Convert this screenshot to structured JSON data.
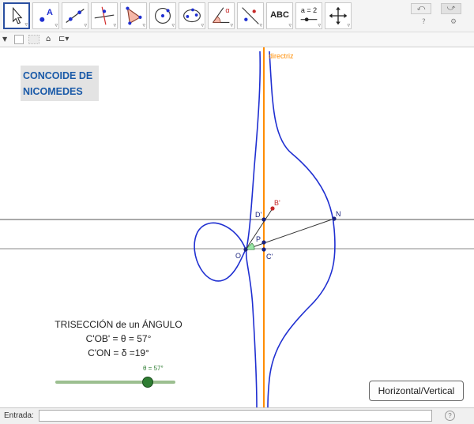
{
  "toolbar": {
    "tools": [
      {
        "name": "move-tool",
        "icon": "arrow-pointer-icon"
      },
      {
        "name": "point-tool",
        "icon": "point-a-icon",
        "label": "A"
      },
      {
        "name": "line-tool",
        "icon": "line-through-points-icon"
      },
      {
        "name": "perpendicular-tool",
        "icon": "perpendicular-line-icon"
      },
      {
        "name": "polygon-tool",
        "icon": "polygon-icon"
      },
      {
        "name": "circle-tool",
        "icon": "circle-center-point-icon"
      },
      {
        "name": "conic-tool",
        "icon": "ellipse-icon"
      },
      {
        "name": "angle-tool",
        "icon": "angle-icon",
        "label": "α"
      },
      {
        "name": "reflect-tool",
        "icon": "reflect-about-line-icon"
      },
      {
        "name": "text-tool",
        "icon": "text-abc-icon",
        "label": "ABC"
      },
      {
        "name": "slider-tool",
        "icon": "slider-icon",
        "label": "a = 2"
      },
      {
        "name": "move-graphics-tool",
        "icon": "move-graphics-view-icon"
      }
    ],
    "undo_icon": "undo-icon",
    "redo_icon": "redo-icon",
    "help_icon": "help-icon",
    "settings_icon": "gear-icon"
  },
  "stylebar": {
    "toggle_icon": "triangle-down-icon",
    "home_icon": "home-icon",
    "view_icon": "graphics-view-icon"
  },
  "graphics": {
    "title_lines": [
      "CONCOIDE DE",
      "NICOMEDES"
    ],
    "directriz_label": "directriz",
    "point_labels": {
      "B_prime": "B'",
      "D_prime": "D'",
      "N": "N",
      "P": "P",
      "O": "O",
      "C_prime": "C'"
    },
    "trisection_lines": [
      "TRISECCIÓN de un ÁNGULO",
      "C'OB' = θ = 57°",
      "C'ON = δ =19°"
    ],
    "slider": {
      "label": "θ = 57°",
      "value": 57,
      "min": 0,
      "max": 75
    },
    "hv_button_label": "Horizontal/Vertical",
    "colors": {
      "title": "#1a5aa8",
      "conchoid": "#1f2fd1",
      "directriz": "#ff8c00",
      "points": "#1a237e",
      "point_B": "#c62828",
      "slider": "#2e7d32"
    }
  },
  "inputbar": {
    "label": "Entrada:",
    "value": "",
    "help_icon": "help-icon"
  }
}
